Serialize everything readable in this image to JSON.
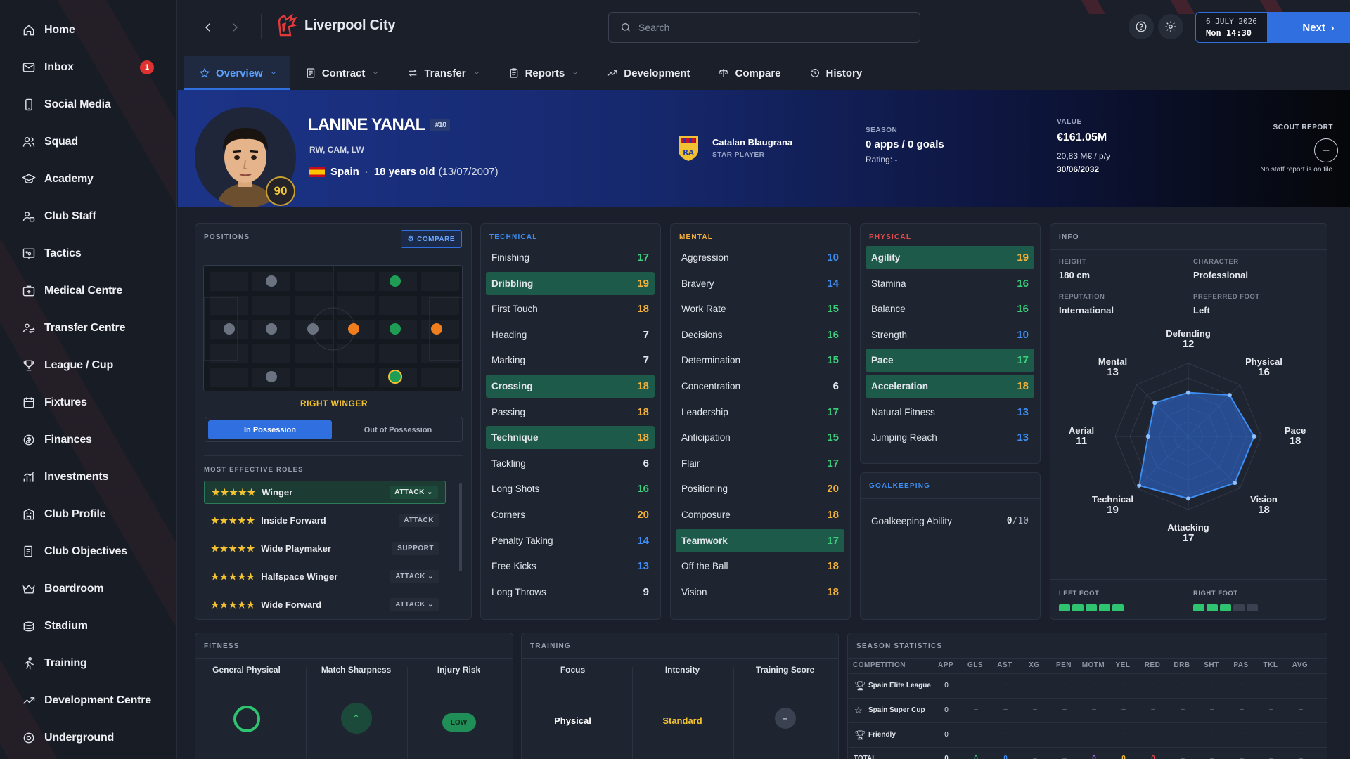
{
  "sidebar": {
    "items": [
      {
        "label": "Home",
        "icon": "home-icon"
      },
      {
        "label": "Inbox",
        "icon": "mail-icon",
        "badge": "1"
      },
      {
        "label": "Social Media",
        "icon": "phone-icon"
      },
      {
        "label": "Squad",
        "icon": "people-icon"
      },
      {
        "label": "Academy",
        "icon": "graduation-cap-icon"
      },
      {
        "label": "Club Staff",
        "icon": "staff-icon"
      },
      {
        "label": "Tactics",
        "icon": "tactics-board-icon"
      },
      {
        "label": "Medical Centre",
        "icon": "medical-icon"
      },
      {
        "label": "Transfer Centre",
        "icon": "transfer-icon"
      },
      {
        "label": "League / Cup",
        "icon": "trophy-icon"
      },
      {
        "label": "Fixtures",
        "icon": "calendar-icon"
      },
      {
        "label": "Finances",
        "icon": "coins-icon"
      },
      {
        "label": "Investments",
        "icon": "chart-up-icon"
      },
      {
        "label": "Club Profile",
        "icon": "building-icon"
      },
      {
        "label": "Club Objectives",
        "icon": "target-icon"
      },
      {
        "label": "Boardroom",
        "icon": "crown-icon"
      },
      {
        "label": "Stadium",
        "icon": "stadium-icon"
      },
      {
        "label": "Training",
        "icon": "running-icon"
      },
      {
        "label": "Development Centre",
        "icon": "trend-icon"
      },
      {
        "label": "Underground",
        "icon": "underground-icon"
      }
    ]
  },
  "header": {
    "club_name": "Liverpool City",
    "search_placeholder": "Search",
    "date_line1": "6 JULY 2026",
    "date_line2": "Mon 14:30",
    "next_label": "Next"
  },
  "tabs": [
    {
      "label": "Overview",
      "active": true,
      "dropdown": true
    },
    {
      "label": "Contract",
      "dropdown": true
    },
    {
      "label": "Transfer",
      "dropdown": true
    },
    {
      "label": "Reports",
      "dropdown": true
    },
    {
      "label": "Development"
    },
    {
      "label": "Compare"
    },
    {
      "label": "History"
    }
  ],
  "player": {
    "name": "LANINE YANAL",
    "shirt": "#10",
    "positions": "RW, CAM, LW",
    "nation": "Spain",
    "age_text": "18 years old",
    "dob": "(13/07/2007)",
    "rating": "90",
    "club": "Catalan Blaugrana",
    "club_tag": "STAR PLAYER",
    "season_label": "SEASON",
    "season_value": "0 apps / 0 goals",
    "season_rating": "Rating: -",
    "value_label": "VALUE",
    "value": "€161.05M",
    "wage": "20,83 M€ / p/y",
    "contract_end": "30/06/2032",
    "scout_label": "SCOUT REPORT",
    "scout_note": "No staff report is on file"
  },
  "positions_panel": {
    "title": "POSITIONS",
    "compare": "COMPARE",
    "role_name": "RIGHT WINGER",
    "in_possession": "In Possession",
    "out_possession": "Out of Possession",
    "roles_title": "MOST EFFECTIVE ROLES",
    "roles": [
      {
        "stars": "★★★★★",
        "name": "Winger",
        "tag": "ATTACK ⌄"
      },
      {
        "stars": "★★★★★",
        "name": "Inside Forward",
        "tag": "ATTACK"
      },
      {
        "stars": "★★★★★",
        "name": "Wide Playmaker",
        "tag": "SUPPORT"
      },
      {
        "stars": "★★★★★",
        "name": "Halfspace Winger",
        "tag": "ATTACK ⌄"
      },
      {
        "stars": "★★★★★",
        "name": "Wide Forward",
        "tag": "ATTACK ⌄"
      }
    ]
  },
  "technical": {
    "title": "TECHNICAL",
    "rows": [
      {
        "n": "Finishing",
        "v": "17"
      },
      {
        "n": "Dribbling",
        "v": "19",
        "hl": true
      },
      {
        "n": "First Touch",
        "v": "18"
      },
      {
        "n": "Heading",
        "v": "7"
      },
      {
        "n": "Marking",
        "v": "7"
      },
      {
        "n": "Crossing",
        "v": "18",
        "hl": true
      },
      {
        "n": "Passing",
        "v": "18"
      },
      {
        "n": "Technique",
        "v": "18",
        "hl": true
      },
      {
        "n": "Tackling",
        "v": "6"
      },
      {
        "n": "Long Shots",
        "v": "16"
      },
      {
        "n": "Corners",
        "v": "20"
      },
      {
        "n": "Penalty Taking",
        "v": "14"
      },
      {
        "n": "Free Kicks",
        "v": "13"
      },
      {
        "n": "Long Throws",
        "v": "9"
      }
    ]
  },
  "mental": {
    "title": "MENTAL",
    "rows": [
      {
        "n": "Aggression",
        "v": "10"
      },
      {
        "n": "Bravery",
        "v": "14"
      },
      {
        "n": "Work Rate",
        "v": "15"
      },
      {
        "n": "Decisions",
        "v": "16"
      },
      {
        "n": "Determination",
        "v": "15"
      },
      {
        "n": "Concentration",
        "v": "6"
      },
      {
        "n": "Leadership",
        "v": "17"
      },
      {
        "n": "Anticipation",
        "v": "15"
      },
      {
        "n": "Flair",
        "v": "17"
      },
      {
        "n": "Positioning",
        "v": "20"
      },
      {
        "n": "Composure",
        "v": "18"
      },
      {
        "n": "Teamwork",
        "v": "17",
        "hl": true
      },
      {
        "n": "Off the Ball",
        "v": "18"
      },
      {
        "n": "Vision",
        "v": "18"
      }
    ]
  },
  "physical": {
    "title": "PHYSICAL",
    "rows": [
      {
        "n": "Agility",
        "v": "19",
        "hl": true
      },
      {
        "n": "Stamina",
        "v": "16"
      },
      {
        "n": "Balance",
        "v": "16"
      },
      {
        "n": "Strength",
        "v": "10"
      },
      {
        "n": "Pace",
        "v": "17",
        "hl": true
      },
      {
        "n": "Acceleration",
        "v": "18",
        "hl": true
      },
      {
        "n": "Natural Fitness",
        "v": "13"
      },
      {
        "n": "Jumping Reach",
        "v": "13"
      }
    ]
  },
  "goalkeeping": {
    "title": "GOALKEEPING",
    "label": "Goalkeeping Ability",
    "value": "0",
    "max": "/10"
  },
  "info": {
    "title": "INFO",
    "height_label": "HEIGHT",
    "height": "180 cm",
    "character_label": "CHARACTER",
    "character": "Professional",
    "reputation_label": "REPUTATION",
    "reputation": "International",
    "foot_label": "PREFERRED FOOT",
    "foot": "Left",
    "left_foot_label": "LEFT FOOT",
    "left_foot_level": 5,
    "right_foot_label": "RIGHT FOOT",
    "right_foot_level": 3,
    "radar": [
      {
        "n": "Defending",
        "v": 12
      },
      {
        "n": "Physical",
        "v": 16
      },
      {
        "n": "Pace",
        "v": 18
      },
      {
        "n": "Vision",
        "v": 18
      },
      {
        "n": "Attacking",
        "v": 17
      },
      {
        "n": "Technical",
        "v": 19
      },
      {
        "n": "Aerial",
        "v": 11
      },
      {
        "n": "Mental",
        "v": 13
      }
    ]
  },
  "fitness": {
    "title": "FITNESS",
    "general": "General Physical",
    "sharpness": "Match Sharpness",
    "injury": "Injury Risk",
    "injury_value": "LOW"
  },
  "training": {
    "title": "TRAINING",
    "focus": "Focus",
    "focus_value": "Physical",
    "intensity": "Intensity",
    "intensity_value": "Standard",
    "score": "Training Score",
    "score_value": "–"
  },
  "season_stats": {
    "title": "SEASON STATISTICS",
    "headers": [
      "COMPETITION",
      "APP",
      "GLS",
      "AST",
      "XG",
      "PEN",
      "MOTM",
      "YEL",
      "RED",
      "DRB",
      "SHT",
      "PAS",
      "TKL",
      "AVG"
    ],
    "rows": [
      {
        "comp": "Spain Elite League",
        "app": "0"
      },
      {
        "comp": "Spain Super Cup",
        "app": "0"
      },
      {
        "comp": "Friendly",
        "app": "0"
      }
    ],
    "total": "TOTAL",
    "total_app": "0",
    "total_gls": "0",
    "total_ast": "0",
    "total_motm": "0",
    "total_yel": "0",
    "total_red": "0",
    "dash": "–"
  },
  "colors": {
    "accent": "#2f6fe0",
    "highlight": "#1e5a4a",
    "green": "#3ad07b",
    "amber": "#f4b23a",
    "blue": "#3d8df2"
  }
}
